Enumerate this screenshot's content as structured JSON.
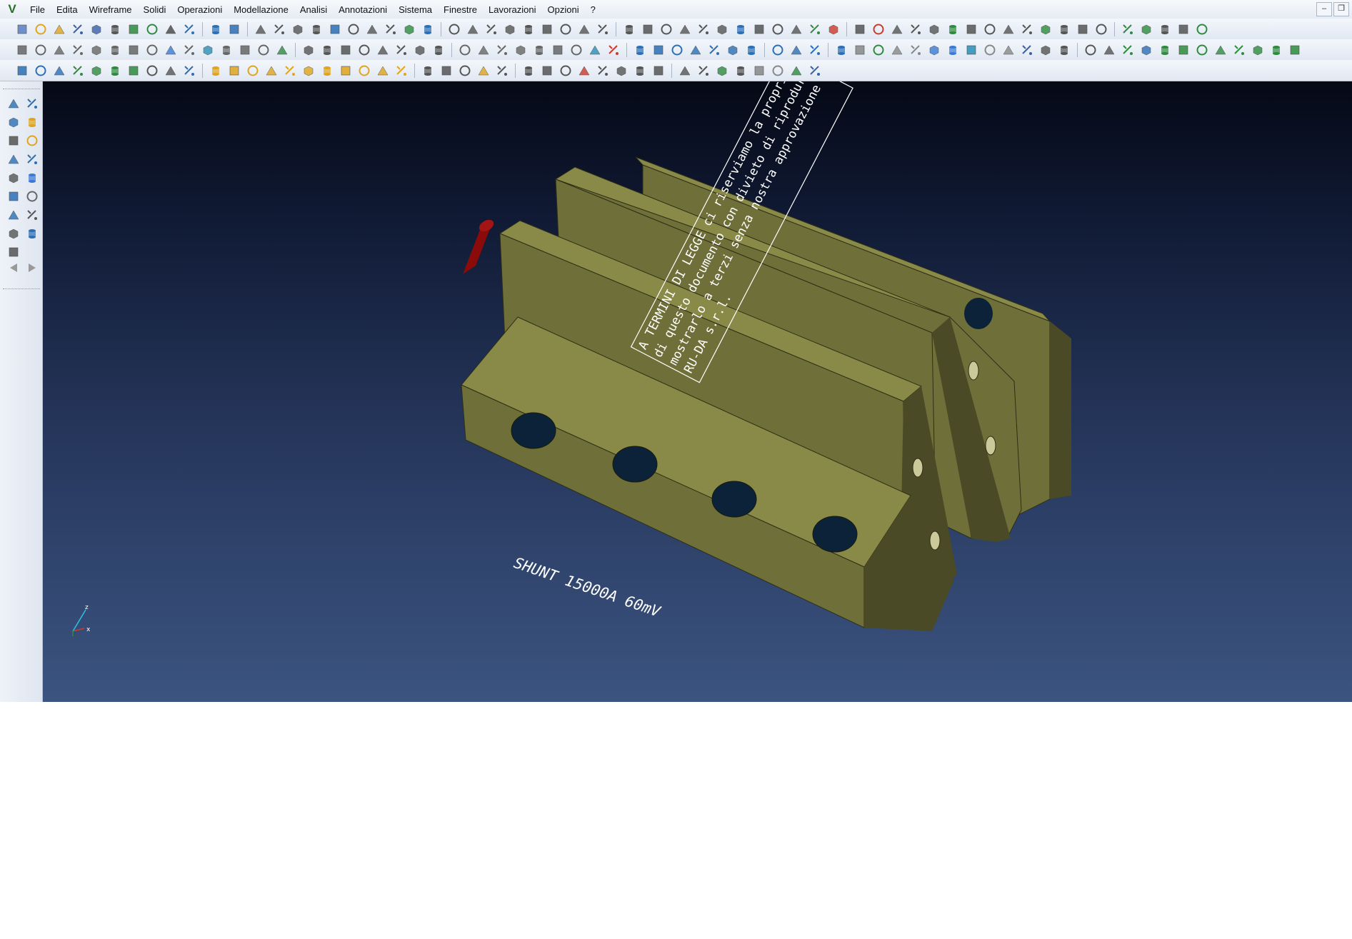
{
  "menu": {
    "items": [
      "File",
      "Edita",
      "Wireframe",
      "Solidi",
      "Operazioni",
      "Modellazione",
      "Analisi",
      "Annotazioni",
      "Sistema",
      "Finestre",
      "Lavorazioni",
      "Opzioni",
      "?"
    ]
  },
  "toolbars": {
    "row1": [
      {
        "name": "new",
        "color": "#5b7fc2"
      },
      {
        "name": "open",
        "color": "#e0a51c"
      },
      {
        "name": "open-folder",
        "color": "#e0a51c"
      },
      {
        "name": "save",
        "color": "#3a5fa8"
      },
      {
        "name": "save-all",
        "color": "#3a5fa8"
      },
      {
        "name": "print",
        "color": "#555555"
      },
      {
        "name": "export",
        "color": "#2e8b3e"
      },
      {
        "name": "import",
        "color": "#2e8b3e"
      },
      {
        "name": "zoom",
        "color": "#444444"
      },
      {
        "name": "view-split",
        "color": "#2b6fb6"
      },
      {
        "sep": true
      },
      {
        "name": "undo",
        "color": "#2b6fb6"
      },
      {
        "name": "redo",
        "color": "#2b6fb6"
      },
      {
        "sep": true
      },
      {
        "name": "trim",
        "color": "#555555"
      },
      {
        "name": "curve",
        "color": "#555555"
      },
      {
        "name": "angle",
        "color": "#555555"
      },
      {
        "name": "mirror",
        "color": "#555555"
      },
      {
        "name": "hatch",
        "color": "#2b6fb6"
      },
      {
        "name": "line",
        "color": "#555555"
      },
      {
        "name": "snap",
        "color": "#555555"
      },
      {
        "name": "extend",
        "color": "#555555"
      },
      {
        "name": "move",
        "color": "#2e8b3e"
      },
      {
        "name": "array",
        "color": "#2b6fb6"
      },
      {
        "sep": true
      },
      {
        "name": "circle-edit",
        "color": "#555555"
      },
      {
        "name": "circle-1",
        "color": "#555555"
      },
      {
        "name": "circle-2",
        "color": "#555555"
      },
      {
        "name": "circle-3",
        "color": "#555555"
      },
      {
        "name": "circle-4",
        "color": "#555555"
      },
      {
        "name": "circle-5",
        "color": "#555555"
      },
      {
        "name": "arc-1",
        "color": "#555555"
      },
      {
        "name": "arc-2",
        "color": "#555555"
      },
      {
        "name": "arc-3",
        "color": "#555555"
      },
      {
        "sep": true
      },
      {
        "name": "tool-a",
        "color": "#555555"
      },
      {
        "name": "tool-b",
        "color": "#555555"
      },
      {
        "name": "tool-c",
        "color": "#555555"
      },
      {
        "name": "tool-d",
        "color": "#555555"
      },
      {
        "name": "tool-e",
        "color": "#555555"
      },
      {
        "name": "tool-f",
        "color": "#555555"
      },
      {
        "name": "tool-g",
        "color": "#2b6fb6"
      },
      {
        "name": "tool-h",
        "color": "#555555"
      },
      {
        "name": "tool-i",
        "color": "#555555"
      },
      {
        "name": "tool-j",
        "color": "#555555"
      },
      {
        "name": "tool-k",
        "color": "#2e8b3e"
      },
      {
        "name": "tool-l",
        "color": "#cc3a2a"
      },
      {
        "sep": true
      },
      {
        "name": "layer-a",
        "color": "#555555"
      },
      {
        "name": "cut",
        "color": "#cc3a2a"
      },
      {
        "name": "dim-a",
        "color": "#555555"
      },
      {
        "name": "dim-b",
        "color": "#555555"
      },
      {
        "name": "dim-c",
        "color": "#555555"
      },
      {
        "name": "refresh",
        "color": "#2e8b3e"
      },
      {
        "name": "render-a",
        "color": "#555555"
      },
      {
        "name": "render-b",
        "color": "#555555"
      },
      {
        "name": "render-c",
        "color": "#555555"
      },
      {
        "name": "render-d",
        "color": "#555555"
      },
      {
        "name": "render-e",
        "color": "#2e8b3e"
      },
      {
        "name": "render-f",
        "color": "#555555"
      },
      {
        "name": "render-g",
        "color": "#555555"
      },
      {
        "name": "render-h",
        "color": "#555555"
      },
      {
        "sep": true
      },
      {
        "name": "cube-view",
        "color": "#2e8b3e"
      },
      {
        "name": "shield",
        "color": "#2e8b3e"
      },
      {
        "name": "settings",
        "color": "#555555"
      },
      {
        "name": "gear",
        "color": "#555555"
      },
      {
        "name": "package",
        "color": "#2e8b3e"
      }
    ],
    "row2": [
      {
        "name": "box",
        "color": "#666666"
      },
      {
        "name": "cylinder",
        "color": "#666666"
      },
      {
        "name": "cylinder-2",
        "color": "#666666"
      },
      {
        "name": "cone",
        "color": "#666666"
      },
      {
        "name": "sphere",
        "color": "#666666"
      },
      {
        "name": "torus",
        "color": "#666666"
      },
      {
        "name": "link",
        "color": "#666666"
      },
      {
        "name": "solid-a",
        "color": "#666666"
      },
      {
        "name": "solid-b",
        "color": "#3a7bd5"
      },
      {
        "name": "solid-c",
        "color": "#666666"
      },
      {
        "name": "solid-d",
        "color": "#2b8fb6"
      },
      {
        "name": "solid-e",
        "color": "#666666"
      },
      {
        "name": "solid-f",
        "color": "#666666"
      },
      {
        "name": "solid-g",
        "color": "#666666"
      },
      {
        "name": "solid-h",
        "color": "#2e8b3e"
      },
      {
        "sep": true
      },
      {
        "name": "op-a",
        "color": "#555555"
      },
      {
        "name": "op-b",
        "color": "#555555"
      },
      {
        "name": "op-c",
        "color": "#555555"
      },
      {
        "name": "op-d",
        "color": "#555555"
      },
      {
        "name": "op-e",
        "color": "#555555"
      },
      {
        "name": "op-f",
        "color": "#555555"
      },
      {
        "name": "op-g",
        "color": "#555555"
      },
      {
        "name": "op-h",
        "color": "#555555"
      },
      {
        "sep": true
      },
      {
        "name": "mod-a",
        "color": "#666666"
      },
      {
        "name": "mod-b",
        "color": "#666666"
      },
      {
        "name": "mod-c",
        "color": "#666666"
      },
      {
        "name": "mod-d",
        "color": "#666666"
      },
      {
        "name": "mod-e",
        "color": "#666666"
      },
      {
        "name": "mod-f",
        "color": "#666666"
      },
      {
        "name": "mod-g",
        "color": "#666666"
      },
      {
        "name": "mod-h",
        "color": "#2b8fb6"
      },
      {
        "name": "mod-i",
        "color": "#cc3a2a"
      },
      {
        "sep": true
      },
      {
        "name": "help",
        "color": "#2b6fb6"
      },
      {
        "name": "measure-a",
        "color": "#2b6fb6"
      },
      {
        "name": "measure-b",
        "color": "#2b6fb6"
      },
      {
        "name": "measure-c",
        "color": "#2b6fb6"
      },
      {
        "name": "measure-d",
        "color": "#2b6fb6"
      },
      {
        "name": "measure-e",
        "color": "#2b6fb6"
      },
      {
        "name": "measure-f",
        "color": "#2b6fb6"
      },
      {
        "sep": true
      },
      {
        "name": "surface-a",
        "color": "#2b6fb6"
      },
      {
        "name": "surface-b",
        "color": "#2b6fb6"
      },
      {
        "name": "surface-c",
        "color": "#2b6fb6"
      },
      {
        "sep": true
      },
      {
        "name": "rotate-view",
        "color": "#2b6fb6"
      },
      {
        "name": "tube-a",
        "color": "#888888"
      },
      {
        "name": "tube-b",
        "color": "#2e8b3e"
      },
      {
        "name": "tube-c",
        "color": "#888888"
      },
      {
        "name": "tube-d",
        "color": "#888888"
      },
      {
        "name": "tube-e",
        "color": "#3a7bd5"
      },
      {
        "name": "tube-f",
        "color": "#3a7bd5"
      },
      {
        "name": "tube-g",
        "color": "#2b8fb6"
      },
      {
        "name": "tube-h",
        "color": "#888888"
      },
      {
        "name": "tube-i",
        "color": "#888888"
      },
      {
        "name": "tube-j",
        "color": "#3a5fa8"
      },
      {
        "name": "tube-k",
        "color": "#555555"
      },
      {
        "name": "tube-l",
        "color": "#555555"
      },
      {
        "sep": true
      },
      {
        "name": "view-a",
        "color": "#555555"
      },
      {
        "name": "view-b",
        "color": "#555555"
      },
      {
        "name": "view-c",
        "color": "#2e8b3e"
      },
      {
        "name": "view-d",
        "color": "#2b6fb6"
      },
      {
        "name": "view-cube-1",
        "color": "#2e8b3e"
      },
      {
        "name": "view-cube-2",
        "color": "#2e8b3e"
      },
      {
        "name": "view-cube-3",
        "color": "#2e8b3e"
      },
      {
        "name": "view-cube-4",
        "color": "#2e8b3e"
      },
      {
        "name": "view-cube-5",
        "color": "#2e8b3e"
      },
      {
        "name": "view-cube-6",
        "color": "#2e8b3e"
      },
      {
        "name": "view-cube-7",
        "color": "#2e8b3e"
      },
      {
        "name": "view-cube-8",
        "color": "#2e8b3e"
      }
    ],
    "row3": [
      {
        "name": "anim-a",
        "color": "#2b6fb6"
      },
      {
        "name": "anim-b",
        "color": "#2b6fb6"
      },
      {
        "name": "anim-c",
        "color": "#2b6fb6"
      },
      {
        "name": "anim-d",
        "color": "#2e8b3e"
      },
      {
        "name": "anim-e",
        "color": "#2e8b3e"
      },
      {
        "name": "anim-f",
        "color": "#2e8b3e"
      },
      {
        "name": "anim-g",
        "color": "#2e8b3e"
      },
      {
        "name": "anim-h",
        "color": "#555555"
      },
      {
        "name": "anim-i",
        "color": "#555555"
      },
      {
        "name": "anim-j",
        "color": "#2b6fb6"
      },
      {
        "sep": true
      },
      {
        "name": "sel-a",
        "color": "#e0a51c"
      },
      {
        "name": "sel-b",
        "color": "#e0a51c"
      },
      {
        "name": "sel-c",
        "color": "#e0a51c"
      },
      {
        "name": "sel-d",
        "color": "#e0a51c"
      },
      {
        "name": "sel-e",
        "color": "#e0a51c"
      },
      {
        "name": "sel-f",
        "color": "#e0a51c"
      },
      {
        "name": "sel-g",
        "color": "#e0a51c"
      },
      {
        "name": "sel-h",
        "color": "#e0a51c"
      },
      {
        "name": "sel-i",
        "color": "#e0a51c"
      },
      {
        "name": "sel-j",
        "color": "#e0a51c"
      },
      {
        "name": "sel-k",
        "color": "#e0a51c"
      },
      {
        "sep": true
      },
      {
        "name": "doc-a",
        "color": "#555555"
      },
      {
        "name": "doc-b",
        "color": "#555555"
      },
      {
        "name": "doc-c",
        "color": "#555555"
      },
      {
        "name": "doc-d",
        "color": "#e0a51c"
      },
      {
        "name": "doc-e",
        "color": "#555555"
      },
      {
        "sep": true
      },
      {
        "name": "anno-a",
        "color": "#555555"
      },
      {
        "name": "anno-b",
        "color": "#555555"
      },
      {
        "name": "anno-c",
        "color": "#555555"
      },
      {
        "name": "spell",
        "color": "#cc3a2a"
      },
      {
        "name": "anno-d",
        "color": "#555555"
      },
      {
        "name": "anno-e",
        "color": "#555555"
      },
      {
        "name": "anno-f",
        "color": "#555555"
      },
      {
        "name": "anno-g",
        "color": "#555555"
      },
      {
        "sep": true
      },
      {
        "name": "mach-a",
        "color": "#555555"
      },
      {
        "name": "mach-b",
        "color": "#555555"
      },
      {
        "name": "mach-c",
        "color": "#2e8b3e"
      },
      {
        "name": "mach-d",
        "color": "#555555"
      },
      {
        "name": "mach-e",
        "color": "#888888"
      },
      {
        "name": "mach-f",
        "color": "#888888"
      },
      {
        "name": "mach-g",
        "color": "#2e8b3e"
      },
      {
        "name": "mach-h",
        "color": "#3a5fa8"
      }
    ]
  },
  "leftbar": [
    {
      "name": "select-a",
      "color": "#2b6fb6"
    },
    {
      "name": "select-b",
      "color": "#2b6fb6"
    },
    {
      "name": "frame-a",
      "color": "#2b6fb6"
    },
    {
      "name": "frame-b",
      "color": "#e0a51c"
    },
    {
      "name": "tool-a",
      "color": "#555555"
    },
    {
      "name": "tool-b",
      "color": "#e0a51c"
    },
    {
      "name": "tool-c",
      "color": "#2b6fb6"
    },
    {
      "name": "tool-d",
      "color": "#2b6fb6"
    },
    {
      "name": "tool-e",
      "color": "#555555"
    },
    {
      "name": "tool-f",
      "color": "#3a7bd5"
    },
    {
      "name": "refresh",
      "color": "#2b6fb6"
    },
    {
      "name": "box",
      "color": "#666666"
    },
    {
      "name": "help",
      "color": "#2b6fb6"
    },
    {
      "name": "measure",
      "color": "#555555"
    },
    {
      "name": "clipboard",
      "color": "#555555"
    },
    {
      "name": "undo",
      "color": "#2b6fb6"
    },
    {
      "name": "list",
      "color": "#555555"
    },
    {
      "name": "back-arrow",
      "color": "#999999"
    },
    {
      "name": "forward-arrow",
      "color": "#999999"
    }
  ],
  "viewport": {
    "copyright_lines": [
      "A TERMINI DI LEGGE ci riserviamo la proprietà e di",
      "di questo documento con divieto di riprodurlo e di",
      "mostrarlo a terzi senza nostra approvazione scritta.",
      "RU-DA s.r.l."
    ],
    "part_label": "SHUNT 15000A 60mV",
    "axis_labels": {
      "x": "x",
      "z": "z"
    },
    "colors": {
      "plate_top": "#8a8a48",
      "plate_front": "#6f6f3a",
      "plate_side": "#4a4a26",
      "resistor": "#8b0b0b",
      "hole": "#0b2238"
    }
  }
}
